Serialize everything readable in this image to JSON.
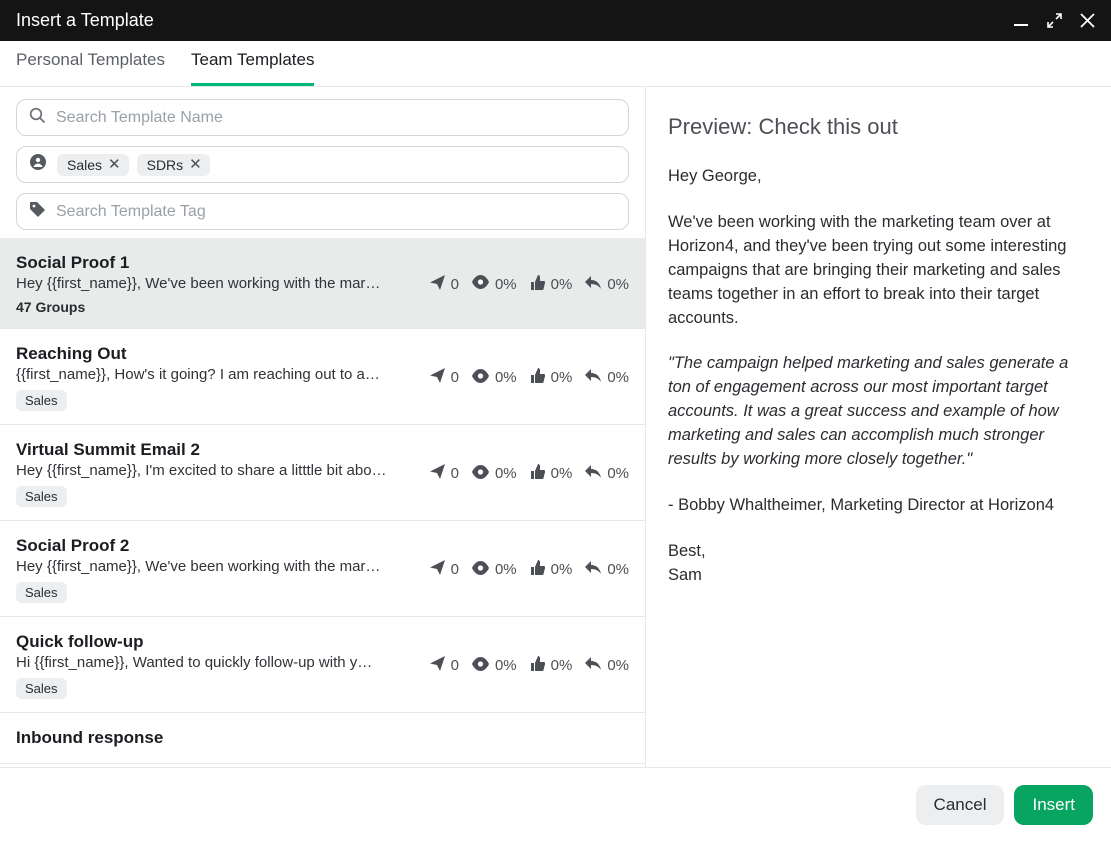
{
  "window": {
    "title": "Insert a Template"
  },
  "tabs": {
    "personal": "Personal Templates",
    "team": "Team Templates"
  },
  "filters": {
    "search_placeholder": "Search Template Name",
    "tag_placeholder": "Search Template Tag",
    "group_chips": [
      "Sales",
      "SDRs"
    ]
  },
  "templates": [
    {
      "title": "Social Proof 1",
      "snippet": "Hey {{first_name}}, We've been working with the mar…",
      "footer_text": "47 Groups",
      "tags": [],
      "selected": true,
      "stats": {
        "sent": "0",
        "opens": "0%",
        "clicks": "0%",
        "replies": "0%"
      }
    },
    {
      "title": "Reaching Out",
      "snippet": "{{first_name}}, How's it going? I am reaching out to a…",
      "tags": [
        "Sales"
      ],
      "stats": {
        "sent": "0",
        "opens": "0%",
        "clicks": "0%",
        "replies": "0%"
      }
    },
    {
      "title": "Virtual Summit Email 2",
      "snippet": "Hey {{first_name}}, I'm excited to share a litttle bit abo…",
      "tags": [
        "Sales"
      ],
      "stats": {
        "sent": "0",
        "opens": "0%",
        "clicks": "0%",
        "replies": "0%"
      }
    },
    {
      "title": "Social Proof 2",
      "snippet": "Hey {{first_name}}, We've been working with the mar…",
      "tags": [
        "Sales"
      ],
      "stats": {
        "sent": "0",
        "opens": "0%",
        "clicks": "0%",
        "replies": "0%"
      }
    },
    {
      "title": "Quick follow-up",
      "snippet": "Hi {{first_name}}, Wanted to quickly follow-up with y…",
      "tags": [
        "Sales"
      ],
      "stats": {
        "sent": "0",
        "opens": "0%",
        "clicks": "0%",
        "replies": "0%"
      }
    },
    {
      "title": "Inbound response",
      "snippet": "",
      "tags": [],
      "stats": null
    }
  ],
  "preview": {
    "heading": "Preview: Check this out",
    "greeting": "Hey George,",
    "para1": "We've been working with the marketing team over at Horizon4, and they've been trying out some interesting campaigns that are bringing their marketing and sales teams together in an effort to break into their target accounts.",
    "quote": "\"The campaign helped marketing and sales generate a ton of engagement across our most important target accounts. It was a great success and example of how marketing and sales can accomplish much stronger results by working more closely together.\"",
    "attribution": "- Bobby Whaltheimer, Marketing Director at Horizon4",
    "closing1": "Best,",
    "closing2": "Sam"
  },
  "footer": {
    "cancel": "Cancel",
    "insert": "Insert"
  }
}
